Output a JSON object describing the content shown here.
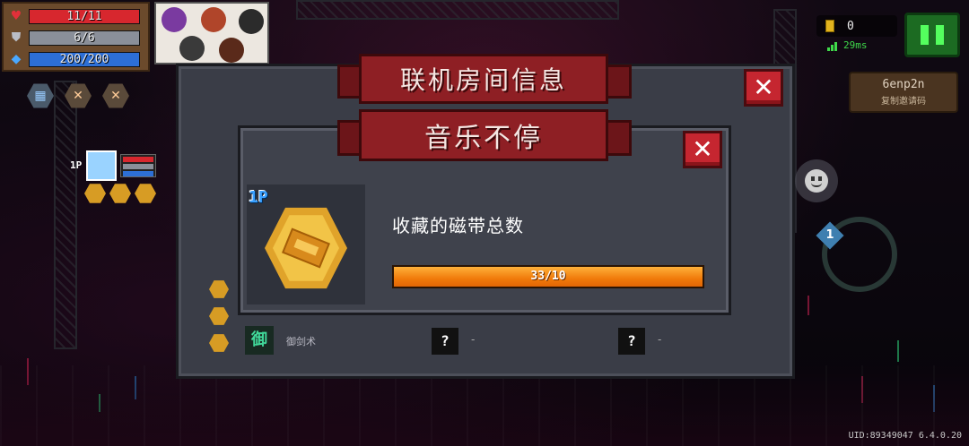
{
  "hud": {
    "health": {
      "text": "11/11",
      "value": 11,
      "max": 11,
      "color": "#d7272e"
    },
    "armor": {
      "text": "6/6",
      "value": 6,
      "max": 6,
      "color": "#8a8f99"
    },
    "energy": {
      "text": "200/200",
      "value": 200,
      "max": 200,
      "color": "#2d6fd6"
    },
    "coins": "0",
    "ping": "29ms",
    "invite_code": "6enp2n",
    "invite_label": "复制邀请码",
    "uid": "UID:89349047 6.4.0.20",
    "player_tag": "1P"
  },
  "outer_dialog": {
    "title": "联机房间信息",
    "skill_name": "御剑术",
    "skill_glyph": "御",
    "unknown_mark": "?",
    "unknown_dash": "-"
  },
  "inner_dialog": {
    "banner": "音乐不停",
    "player_tag": "1P",
    "achievement_title": "收藏的磁带总数",
    "progress_text": "33/10",
    "progress_fraction": 1.0
  },
  "colors": {
    "ribbon": "#8e1f24",
    "close": "#c52630",
    "progress": "#f07a0a",
    "badge": "#e0a32a"
  }
}
